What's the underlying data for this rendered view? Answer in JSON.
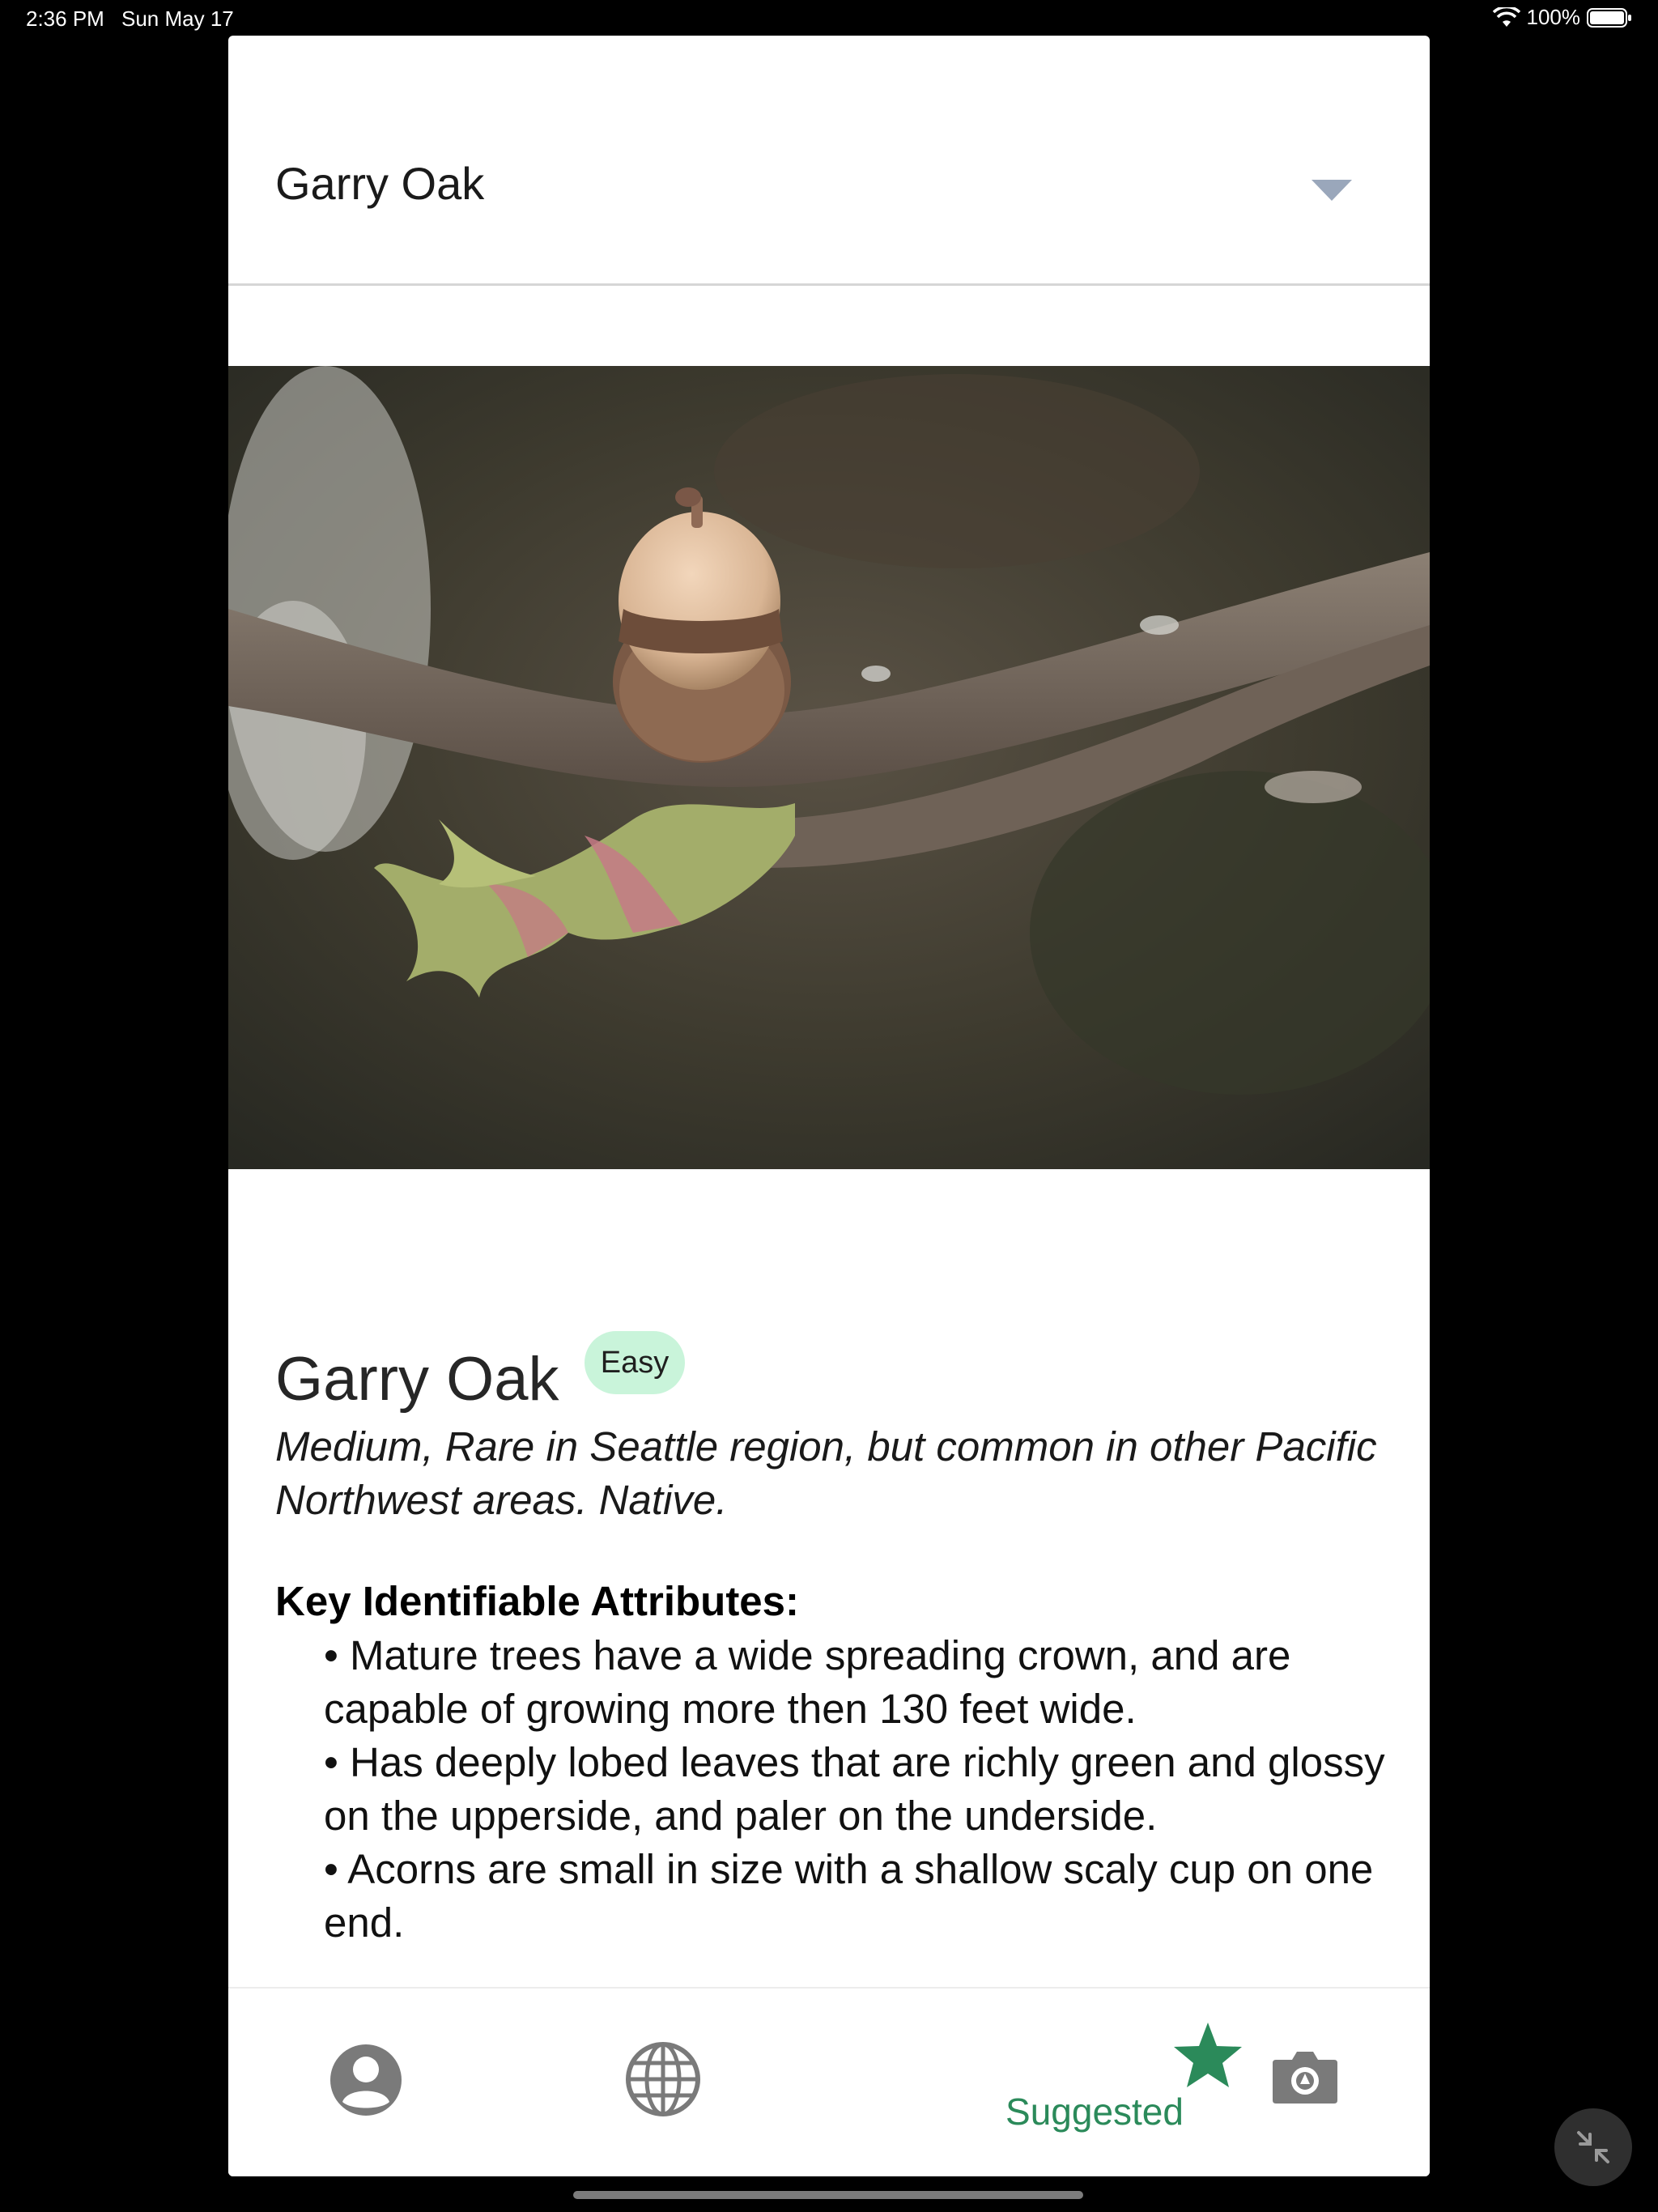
{
  "status_bar": {
    "time": "2:36 PM",
    "date": "Sun May 17",
    "battery": "100%"
  },
  "tree_selector": {
    "value": "Garry Oak"
  },
  "tree": {
    "name": "Garry Oak",
    "difficulty": "Easy",
    "summary": "Medium, Rare in Seattle region, but common in other Pacific Northwest areas. Native.",
    "attributes_heading": "Key Identifiable Attributes:",
    "attributes": [
      "• Mature trees have a wide spreading crown, and are capable of growing more then 130 feet wide.",
      "• Has deeply lobed leaves that are richly green and glossy on the upperside, and paler on the underside.",
      "• Acorns are small in size with a shallow scaly cup on one end."
    ]
  },
  "tab_bar": {
    "tabs": [
      {
        "icon": "profile-icon",
        "label": ""
      },
      {
        "icon": "globe-icon",
        "label": ""
      },
      {
        "icon": "star-icon",
        "label": "Suggested",
        "active": true
      },
      {
        "icon": "camera-icon",
        "label": ""
      }
    ]
  },
  "colors": {
    "accent": "#2b8a5a",
    "badge": "#c9f4da",
    "inactive_icon": "#7a7a7a"
  }
}
